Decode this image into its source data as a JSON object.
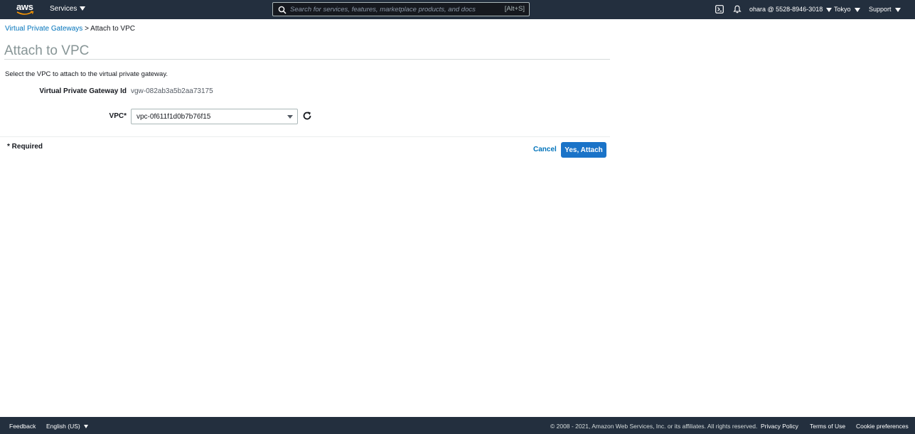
{
  "nav": {
    "logo_text": "aws",
    "services_label": "Services",
    "search_placeholder": "Search for services, features, marketplace products, and docs",
    "search_shortcut": "[Alt+S]",
    "account": "ohara @ 5528-8946-3018",
    "region": "Tokyo",
    "support": "Support"
  },
  "breadcrumb": {
    "parent": "Virtual Private Gateways",
    "separator": ">",
    "current": "Attach to VPC"
  },
  "page": {
    "title": "Attach to VPC",
    "description": "Select the VPC to attach to the virtual private gateway."
  },
  "form": {
    "vgw_label": "Virtual Private Gateway Id",
    "vgw_value": "vgw-082ab3a5b2aa73175",
    "vpc_label": "VPC*",
    "vpc_value": "vpc-0f611f1d0b7b76f15",
    "required_note": "* Required",
    "cancel_label": "Cancel",
    "attach_label": "Yes, Attach"
  },
  "footer": {
    "feedback": "Feedback",
    "language": "English (US)",
    "copyright": "© 2008 - 2021, Amazon Web Services, Inc. or its affiliates. All rights reserved.",
    "privacy": "Privacy Policy",
    "terms": "Terms of Use",
    "cookies": "Cookie preferences"
  },
  "colors": {
    "nav_bg": "#232f3e",
    "link": "#0073bb",
    "primary_button": "#1a73c8",
    "title": "#879596"
  },
  "icons": [
    "aws-logo",
    "caret-down-icon",
    "search-icon",
    "cloudshell-icon",
    "bell-icon",
    "refresh-icon"
  ]
}
